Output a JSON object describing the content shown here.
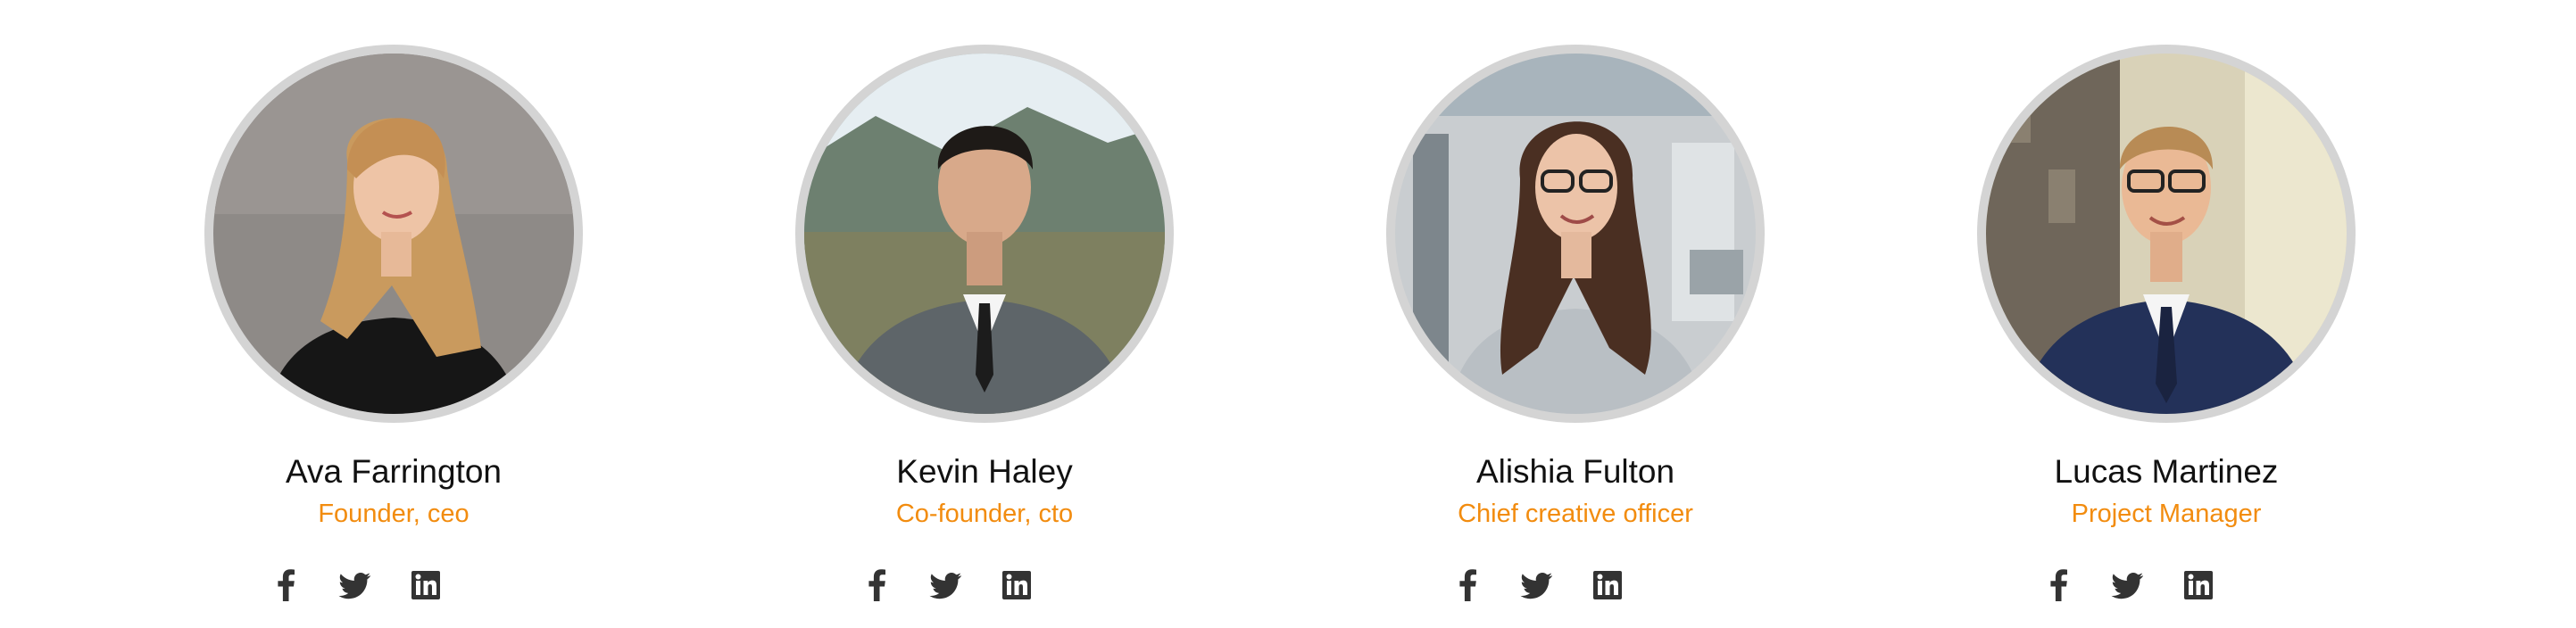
{
  "team": {
    "members": [
      {
        "name": "Ava Farrington",
        "role": "Founder, ceo",
        "photo_icon": "portrait-photo-woman-blonde"
      },
      {
        "name": "Kevin Haley",
        "role": "Co-founder, cto",
        "photo_icon": "portrait-photo-man-suit"
      },
      {
        "name": "Alishia Fulton",
        "role": "Chief creative officer",
        "photo_icon": "portrait-photo-woman-glasses"
      },
      {
        "name": "Lucas Martinez",
        "role": "Project Manager",
        "photo_icon": "portrait-photo-man-glasses"
      }
    ],
    "social_icons": [
      "facebook-icon",
      "twitter-icon",
      "linkedin-icon"
    ]
  },
  "colors": {
    "accent": "#f28c0f",
    "name_text": "#111111",
    "icon": "#333333",
    "ring": "#d4d4d4"
  }
}
